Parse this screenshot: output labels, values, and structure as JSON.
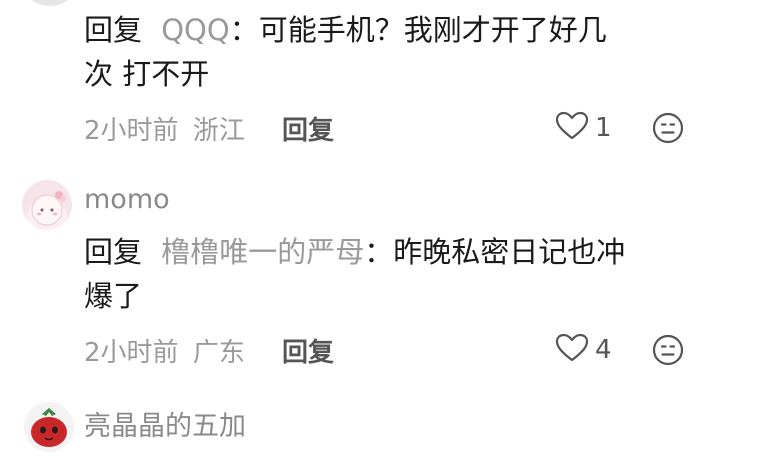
{
  "comments": [
    {
      "reply_word": "回复",
      "reply_target": "QQQ",
      "text_line1": "：可能手机？我刚才开了好几",
      "text_line2": "次 打不开",
      "time": "2小时前",
      "region": "浙江",
      "reply_label": "回复",
      "likes": "1"
    },
    {
      "username": "momo",
      "reply_word": "回复",
      "reply_target": "橹橹唯一的严母",
      "text_line1": "：昨晚私密日记也冲",
      "text_line2": "爆了",
      "time": "2小时前",
      "region": "广东",
      "reply_label": "回复",
      "likes": "4"
    },
    {
      "username": "亮晶晶的五加"
    }
  ],
  "icons": {
    "like": "heart-outline-icon",
    "dislike": "neutral-face-icon"
  },
  "colors": {
    "body_text": "#1a1a1a",
    "secondary_text": "#9a9a9a",
    "action_text": "#555555"
  }
}
